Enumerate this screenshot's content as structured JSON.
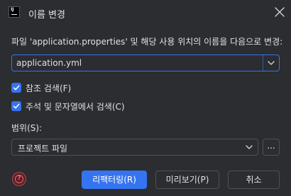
{
  "dialog": {
    "title": "이름 변경",
    "description": "파일 'application.properties' 및 해당 사용 위치의 이름을 다음으로 변경:",
    "new_name": "application.yml",
    "options": [
      {
        "label": "참조 검색(F)",
        "checked": true
      },
      {
        "label": "주석 및 문자열에서 검색(C)",
        "checked": true
      }
    ],
    "scope": {
      "label": "범위(S):",
      "value": "프로젝트 파일",
      "more_label": "..."
    },
    "buttons": {
      "refactor": "리팩터링(R)",
      "preview": "미리보기(P)",
      "cancel": "취소"
    }
  },
  "colors": {
    "background": "#2b2d30",
    "accent": "#3574f0",
    "text": "#dfe1e5",
    "help": "#e26d76"
  }
}
